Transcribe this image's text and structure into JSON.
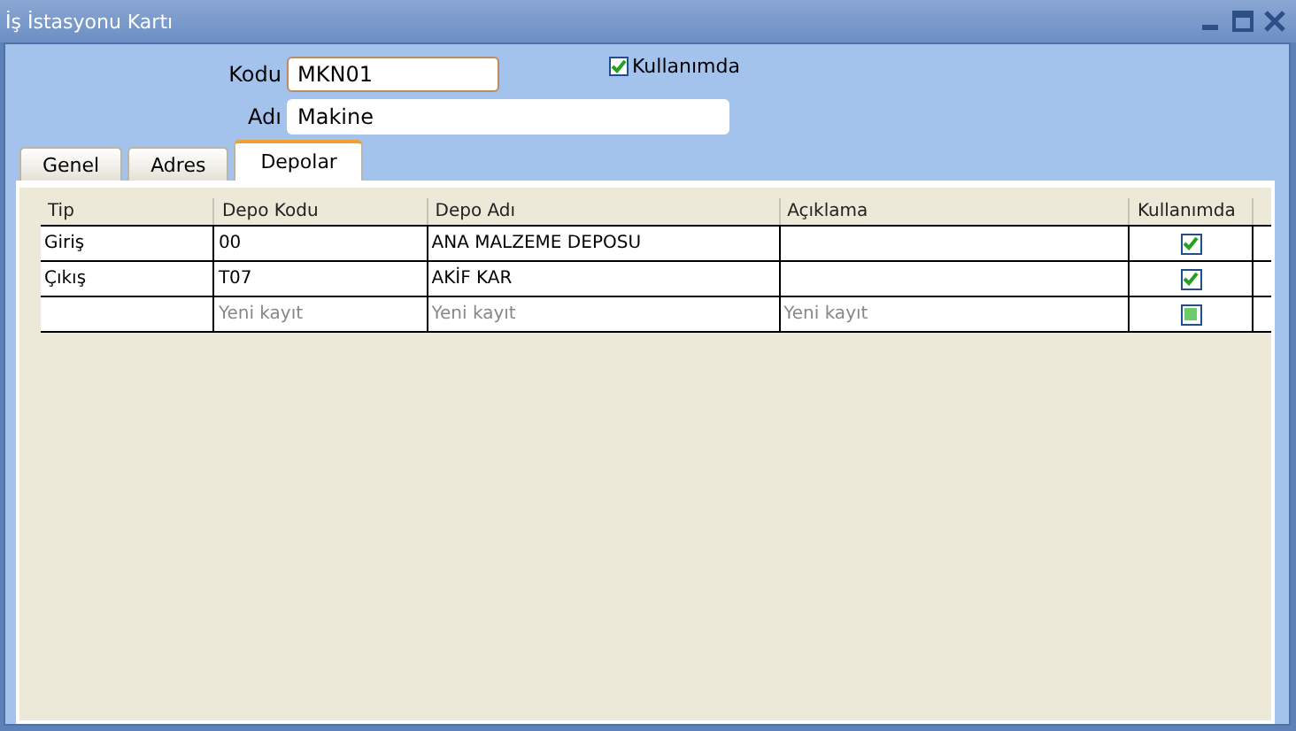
{
  "window": {
    "title": "İş İstasyonu Kartı"
  },
  "form": {
    "code_label": "Kodu",
    "code_value": "MKN01",
    "name_label": "Adı",
    "name_value": "Makine",
    "in_use": {
      "label": "Kullanımda",
      "checked": true
    }
  },
  "tabs": [
    {
      "label": "Genel",
      "selected": false
    },
    {
      "label": "Adres",
      "selected": false
    },
    {
      "label": "Depolar",
      "selected": true
    }
  ],
  "table": {
    "columns": [
      "Tip",
      "Depo Kodu",
      "Depo Adı",
      "Açıklama",
      "Kullanımda"
    ],
    "rows": [
      {
        "kind": "data",
        "cells": [
          "Giriş",
          "00",
          "ANA MALZEME DEPOSU",
          ""
        ],
        "in_use_checked": true
      },
      {
        "kind": "data",
        "cells": [
          "Çıkış",
          "T07",
          "AKİF KAR",
          ""
        ],
        "in_use_checked": true
      },
      {
        "kind": "new",
        "cells": [
          "",
          "Yeni kayıt",
          "Yeni kayıt",
          "Yeni kayıt"
        ],
        "in_use_checked": false
      }
    ]
  }
}
